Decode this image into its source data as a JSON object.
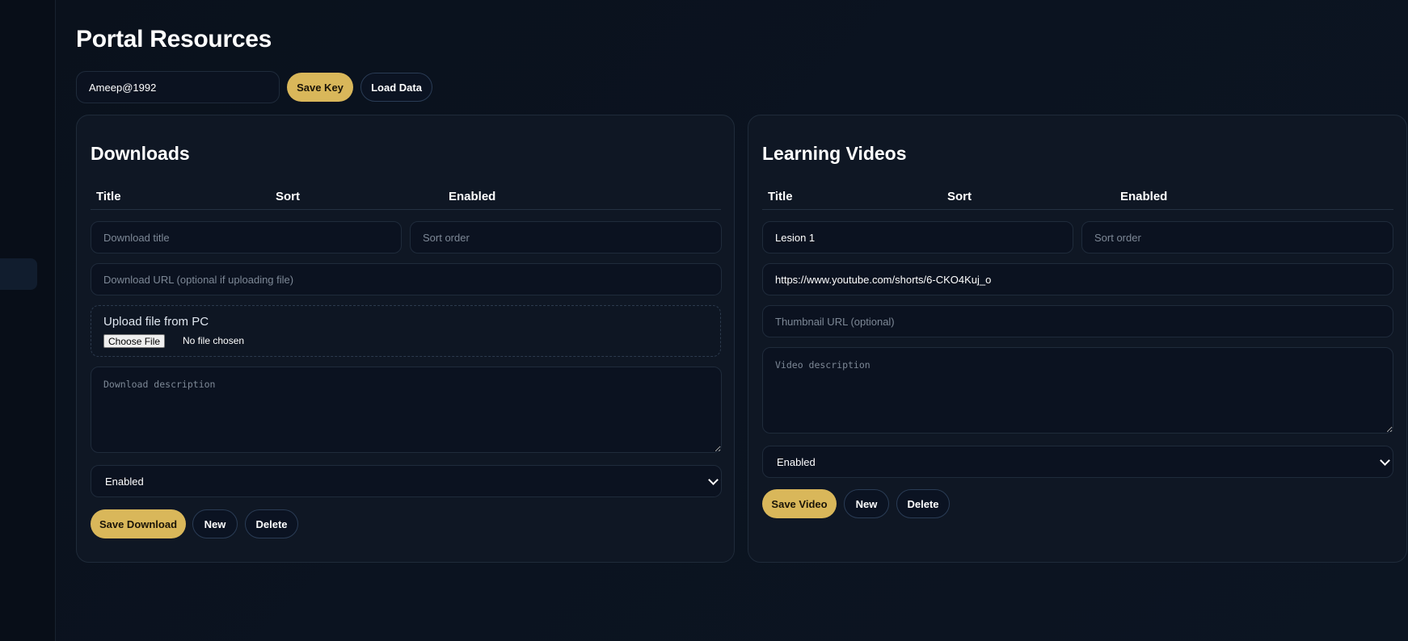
{
  "page": {
    "title": "Portal Resources"
  },
  "key": {
    "value": "Ameep@1992",
    "save_label": "Save Key",
    "load_label": "Load Data"
  },
  "downloads": {
    "title": "Downloads",
    "columns": [
      "Title",
      "Sort",
      "Enabled"
    ],
    "title_placeholder": "Download title",
    "sort_placeholder": "Sort order",
    "url_placeholder": "Download URL (optional if uploading file)",
    "upload_label": "Upload file from PC",
    "choose_file_label": "Choose File",
    "file_status": "No file chosen",
    "description_placeholder": "Download description",
    "status_selected": "Enabled",
    "save_label": "Save Download",
    "new_label": "New",
    "delete_label": "Delete"
  },
  "videos": {
    "title": "Learning Videos",
    "columns": [
      "Title",
      "Sort",
      "Enabled"
    ],
    "title_value": "Lesion 1",
    "sort_placeholder": "Sort order",
    "url_value": "https://www.youtube.com/shorts/6-CKO4Kuj_o",
    "thumbnail_placeholder": "Thumbnail URL (optional)",
    "description_placeholder": "Video description",
    "status_selected": "Enabled",
    "save_label": "Save Video",
    "new_label": "New",
    "delete_label": "Delete"
  },
  "colors": {
    "background": "#0b1320",
    "panel": "#0f1724",
    "accent_gold": "#d9b75a",
    "outline_button_border": "#2a3c55"
  },
  "icons": [
    "chevron-down-icon"
  ]
}
